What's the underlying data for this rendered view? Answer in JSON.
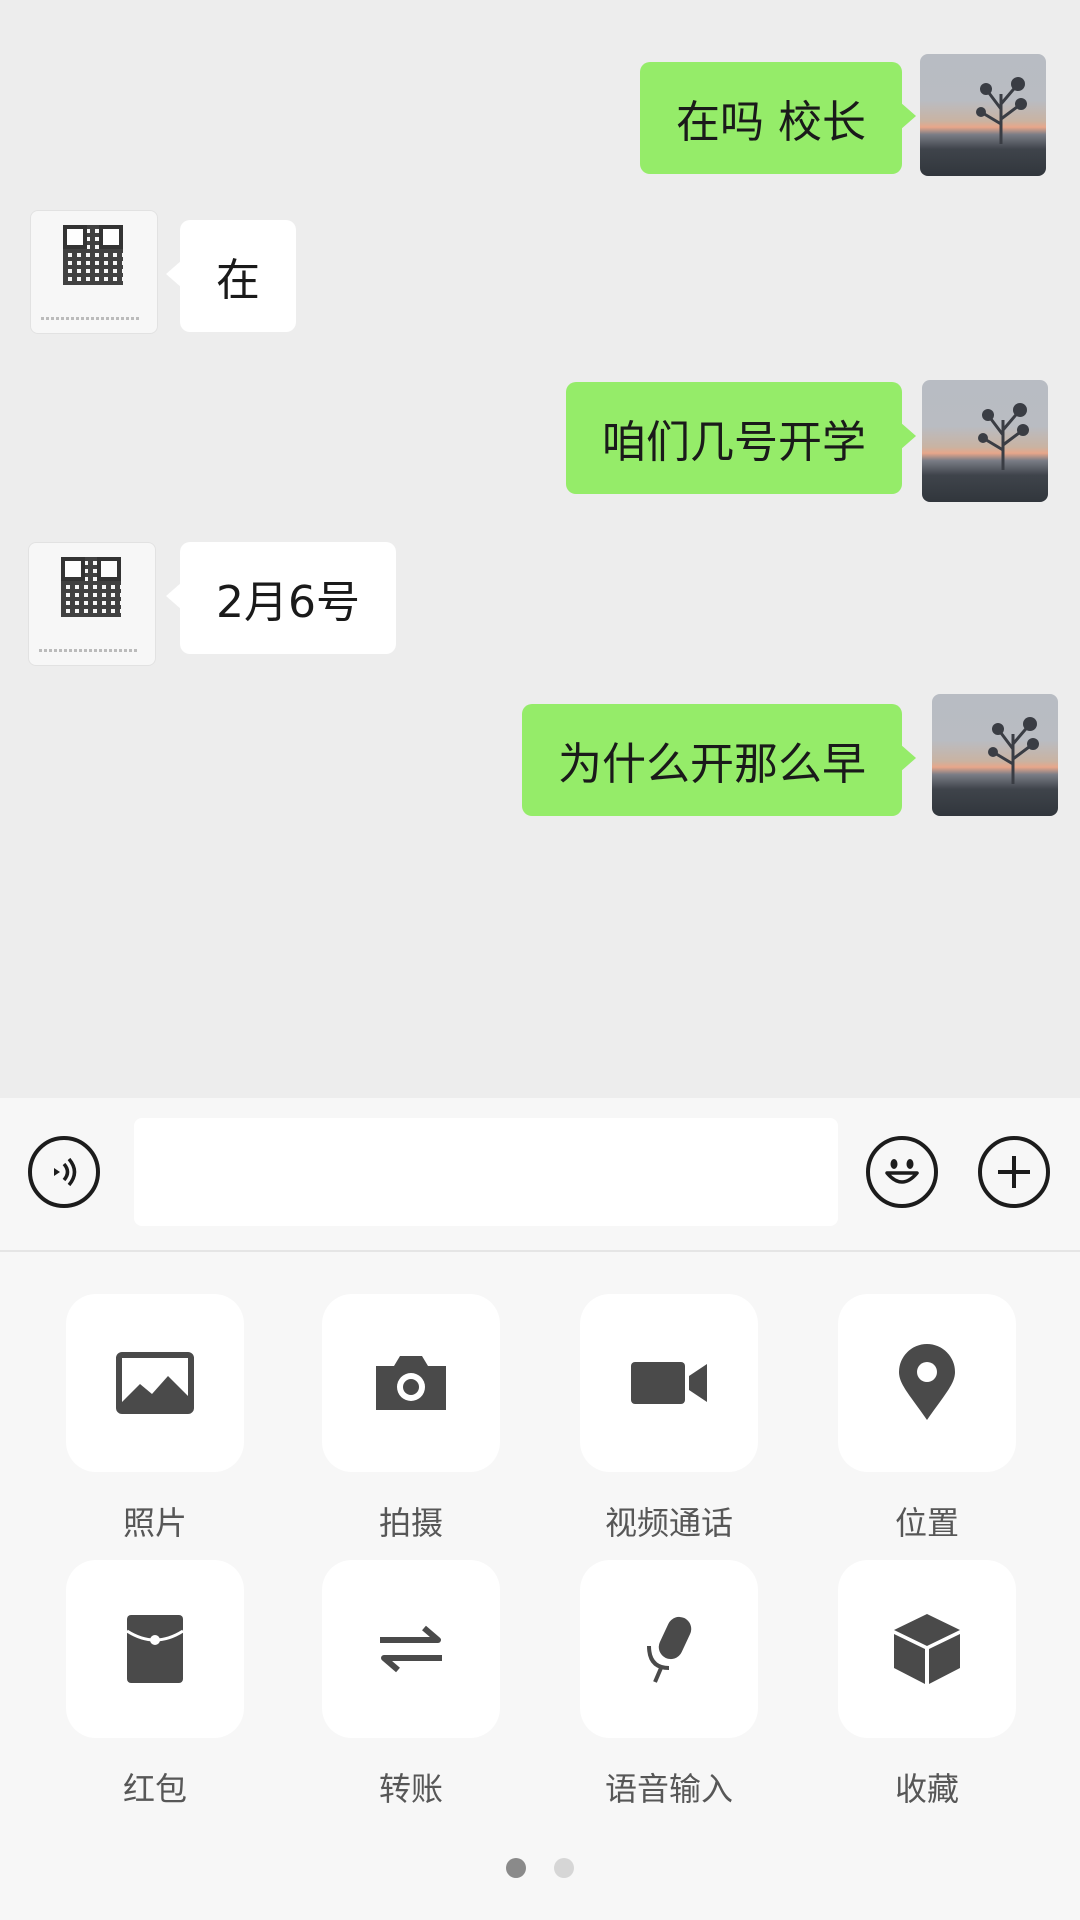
{
  "messages": [
    {
      "side": "sent",
      "text": "在吗 校长"
    },
    {
      "side": "recv",
      "text": "在"
    },
    {
      "side": "sent",
      "text": "咱们几号开学"
    },
    {
      "side": "recv",
      "text": "2月6号"
    },
    {
      "side": "sent",
      "text": "为什么开那么早"
    }
  ],
  "input_bar": {
    "voice_icon": "voice-icon",
    "text_value": "",
    "emoji_icon": "emoji-icon",
    "plus_icon": "plus-icon"
  },
  "tools": [
    {
      "label": "照片",
      "icon": "photo-icon"
    },
    {
      "label": "拍摄",
      "icon": "camera-icon"
    },
    {
      "label": "视频通话",
      "icon": "video-call-icon"
    },
    {
      "label": "位置",
      "icon": "location-icon"
    },
    {
      "label": "红包",
      "icon": "red-packet-icon"
    },
    {
      "label": "转账",
      "icon": "transfer-icon"
    },
    {
      "label": "语音输入",
      "icon": "microphone-icon"
    },
    {
      "label": "收藏",
      "icon": "favorites-icon"
    }
  ],
  "pager": {
    "pages": 2,
    "current": 1
  },
  "colors": {
    "chat_bg": "#ededed",
    "sent_bubble": "#95ec69",
    "recv_bubble": "#ffffff",
    "icon": "#4a4a4a",
    "active_dot": "#8a8a8a",
    "inactive_dot": "#d6d6d6"
  }
}
